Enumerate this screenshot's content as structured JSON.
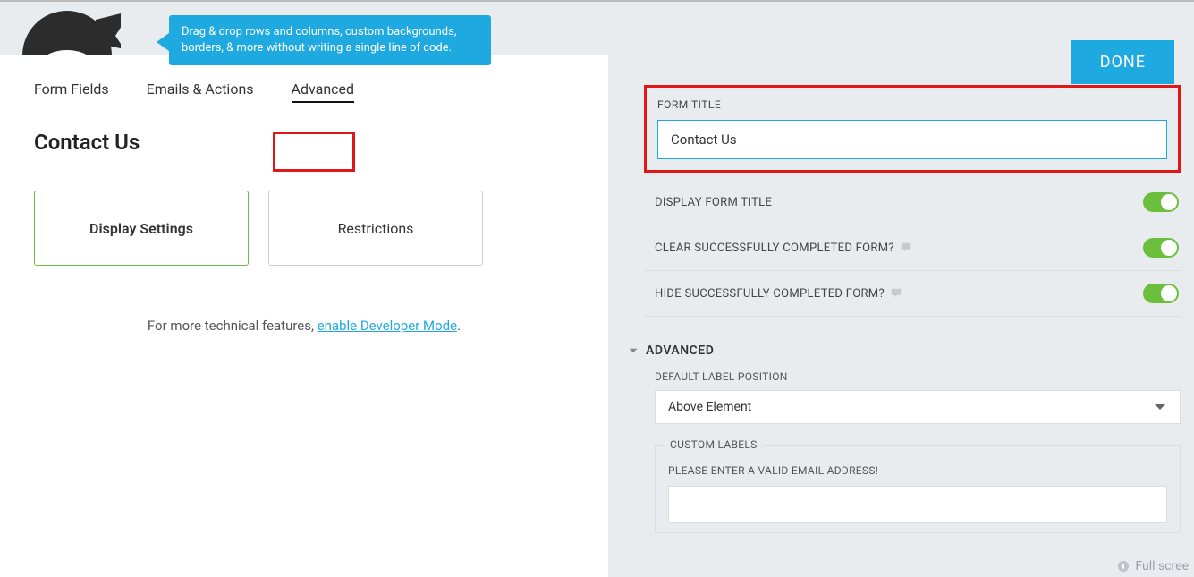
{
  "tooltip": {
    "text": "Drag & drop rows and columns, custom backgrounds, borders, & more without writing a single line of code."
  },
  "tabs": {
    "form_fields": "Form Fields",
    "emails_actions": "Emails & Actions",
    "advanced": "Advanced"
  },
  "page_title": "Contact Us",
  "cards": {
    "display_settings": "Display Settings",
    "restrictions": "Restrictions"
  },
  "more_text_prefix": "For more technical features, ",
  "more_link": "enable Developer Mode",
  "done": "DONE",
  "form_title": {
    "label": "FORM TITLE",
    "value": "Contact Us"
  },
  "toggles": {
    "display_title": "DISPLAY FORM TITLE",
    "clear_completed": "CLEAR SUCCESSFULLY COMPLETED FORM?",
    "hide_completed": "HIDE SUCCESSFULLY COMPLETED FORM?"
  },
  "advanced": {
    "header": "ADVANCED",
    "default_label_pos": {
      "label": "DEFAULT LABEL POSITION",
      "value": "Above Element"
    },
    "custom_labels": {
      "legend": "CUSTOM LABELS",
      "email_msg": "PLEASE ENTER A VALID EMAIL ADDRESS!"
    }
  },
  "fullscreen": "Full scree"
}
